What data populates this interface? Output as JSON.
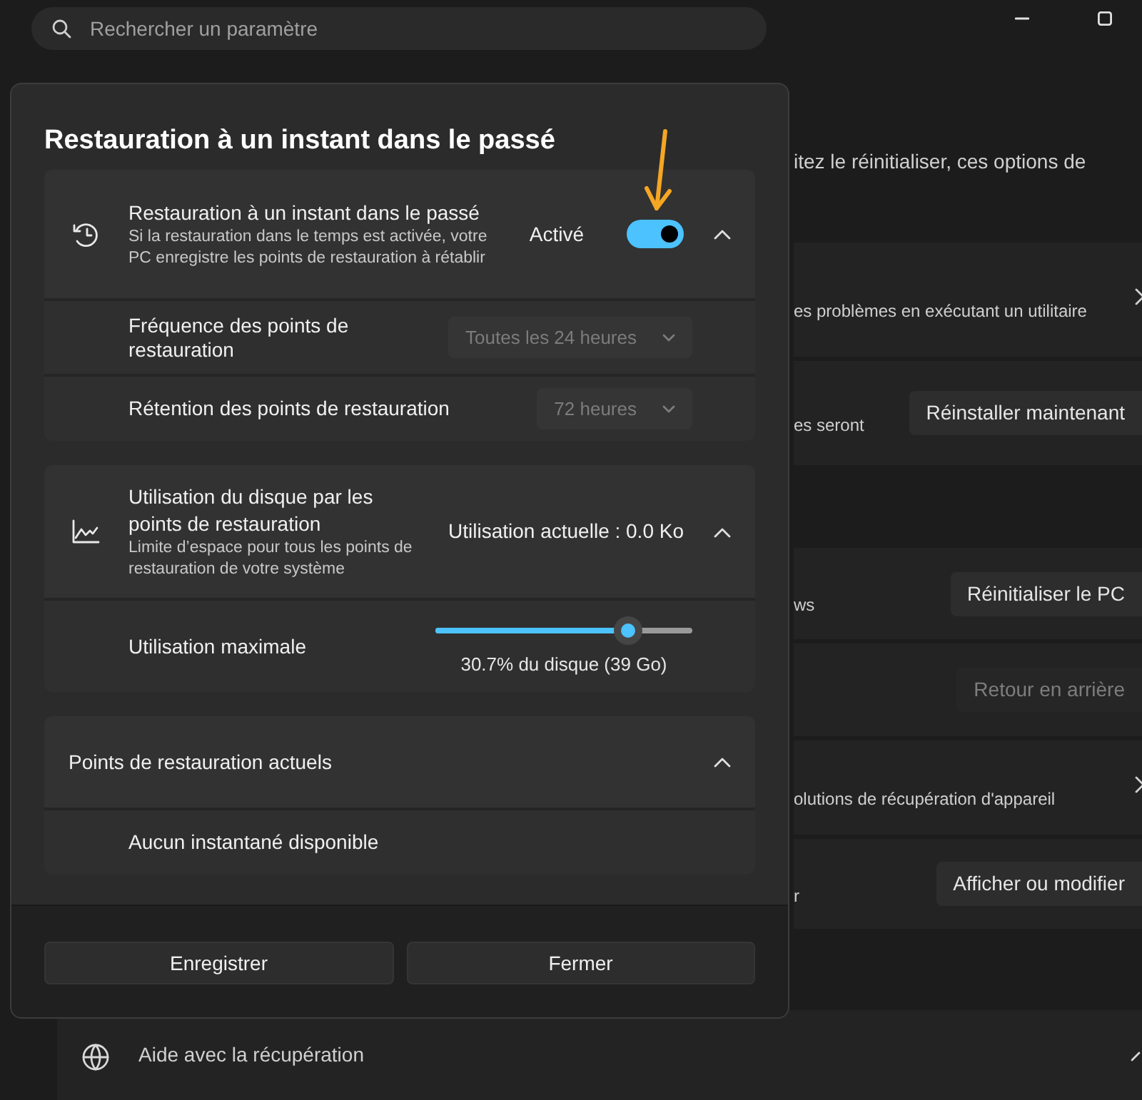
{
  "search": {
    "placeholder": "Rechercher un paramètre"
  },
  "background": {
    "description": "itez le réinitialiser, ces options de",
    "groups": [
      {
        "rows": [
          {
            "kind": "link",
            "text": "es problèmes en exécutant un utilitaire"
          },
          {
            "kind": "button",
            "text": "es seront",
            "button": "Réinstaller maintenant",
            "disabled": false
          }
        ]
      },
      {
        "rows": [
          {
            "kind": "button",
            "text": "ws",
            "button": "Réinitialiser le PC",
            "disabled": false
          },
          {
            "kind": "button",
            "button": "Retour en arrière",
            "disabled": true
          },
          {
            "kind": "link",
            "text": "olutions de récupération d'appareil"
          },
          {
            "kind": "button",
            "text": "r",
            "button": "Afficher ou modifier",
            "disabled": false
          }
        ]
      }
    ]
  },
  "help": {
    "label": "Aide avec la récupération"
  },
  "dialog": {
    "title": "Restauration à un instant dans le passé",
    "sections": [
      {
        "title": "Restauration à un instant dans le passé",
        "description": "Si la restauration dans le temps est activée, votre PC enregistre les points de restauration à rétablir",
        "status": "Activé",
        "toggle": {
          "on": true
        },
        "expanded": true,
        "rows": [
          {
            "kind": "dropdown",
            "label": "Fréquence des points de restauration",
            "value": "Toutes les 24 heures",
            "disabled": true
          },
          {
            "kind": "dropdown",
            "label": "Rétention des points de restauration",
            "value": "72 heures",
            "disabled": true
          }
        ]
      },
      {
        "title": "Utilisation du disque par les points de restauration",
        "description": "Limite d’espace pour tous les points de restauration de votre système",
        "status": "Utilisation actuelle : 0.0 Ko",
        "expanded": true,
        "rows": [
          {
            "kind": "slider",
            "label": "Utilisation maximale",
            "level": 0.75,
            "reading": "30.7% du disque (39 Go)"
          }
        ]
      },
      {
        "title": "Points de restauration actuels",
        "expanded": true,
        "rows": [
          {
            "kind": "text",
            "label": "Aucun instantané disponible"
          }
        ]
      }
    ],
    "buttons": [
      {
        "label": "Enregistrer"
      },
      {
        "label": "Fermer"
      }
    ]
  }
}
